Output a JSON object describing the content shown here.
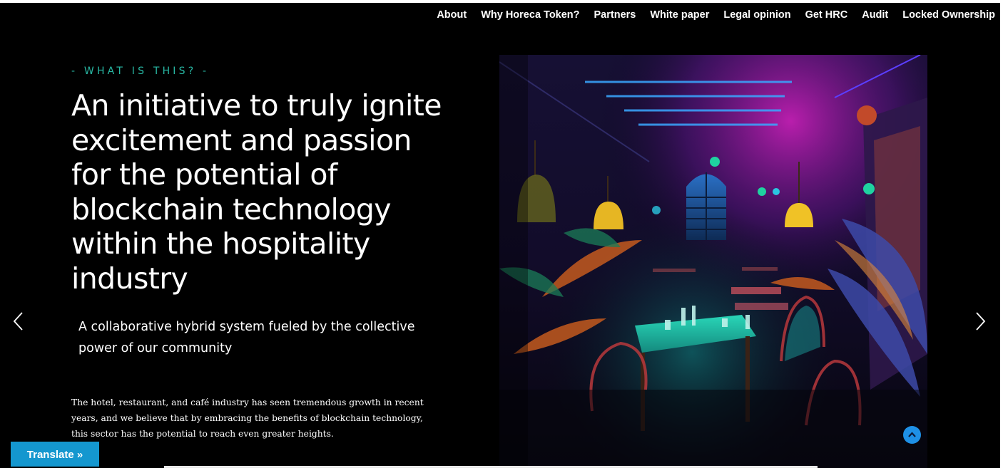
{
  "nav": {
    "items": [
      "About",
      "Why Horeca Token?",
      "Partners",
      "White paper",
      "Legal opinion",
      "Get HRC",
      "Audit",
      "Locked Ownership"
    ]
  },
  "hero": {
    "kicker": "- WHAT IS THIS? -",
    "headline": "An initiative to truly ignite excitement and passion for the potential of blockchain technology within the hospitality industry",
    "subhead": "A collaborative hybrid system fueled by the collective power of our community",
    "body": "The hotel, restaurant, and café industry has seen tremendous growth in recent years, and we believe that by embracing the benefits of blockchain technology, this sector has the potential to reach even greater heights."
  },
  "controls": {
    "translate_label": "Translate »",
    "prev_icon": "chevron-left-icon",
    "next_icon": "chevron-right-icon",
    "scroll_top_icon": "chevron-up-icon"
  },
  "colors": {
    "accent": "#28b7a3",
    "translate_bg": "#1497cf",
    "scroll_top_bg": "#1e90e6",
    "background": "#000000"
  }
}
